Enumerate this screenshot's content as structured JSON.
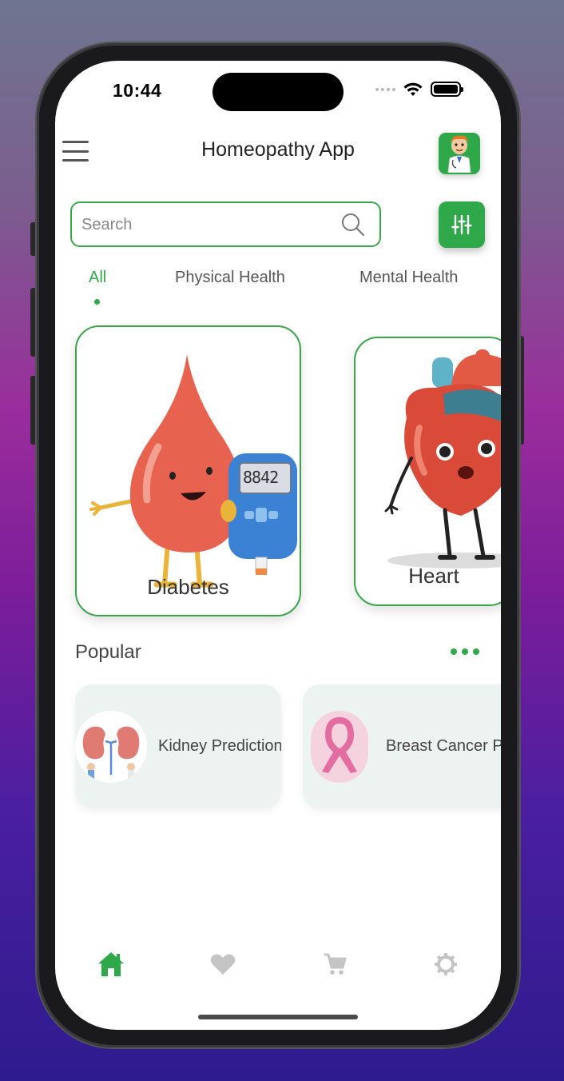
{
  "status_bar": {
    "time": "10:44"
  },
  "header": {
    "title": "Homeopathy App"
  },
  "search": {
    "placeholder": "Search",
    "value": ""
  },
  "tabs": [
    {
      "label": "All",
      "active": true
    },
    {
      "label": "Physical Health",
      "active": false
    },
    {
      "label": "Mental Health",
      "active": false
    }
  ],
  "categories": [
    {
      "label": "Diabetes",
      "glucometer_reading": "8842"
    },
    {
      "label": "Heart"
    }
  ],
  "popular": {
    "title": "Popular",
    "items": [
      {
        "label": "Kidney Prediction"
      },
      {
        "label": "Breast Cancer Prediction"
      }
    ]
  },
  "bottom_nav": [
    {
      "icon": "home-icon",
      "active": true
    },
    {
      "icon": "heart-icon",
      "active": false
    },
    {
      "icon": "cart-icon",
      "active": false
    },
    {
      "icon": "settings-icon",
      "active": false
    }
  ],
  "colors": {
    "accent": "#2fa84a",
    "inactive_icon": "#c4c4c4"
  }
}
